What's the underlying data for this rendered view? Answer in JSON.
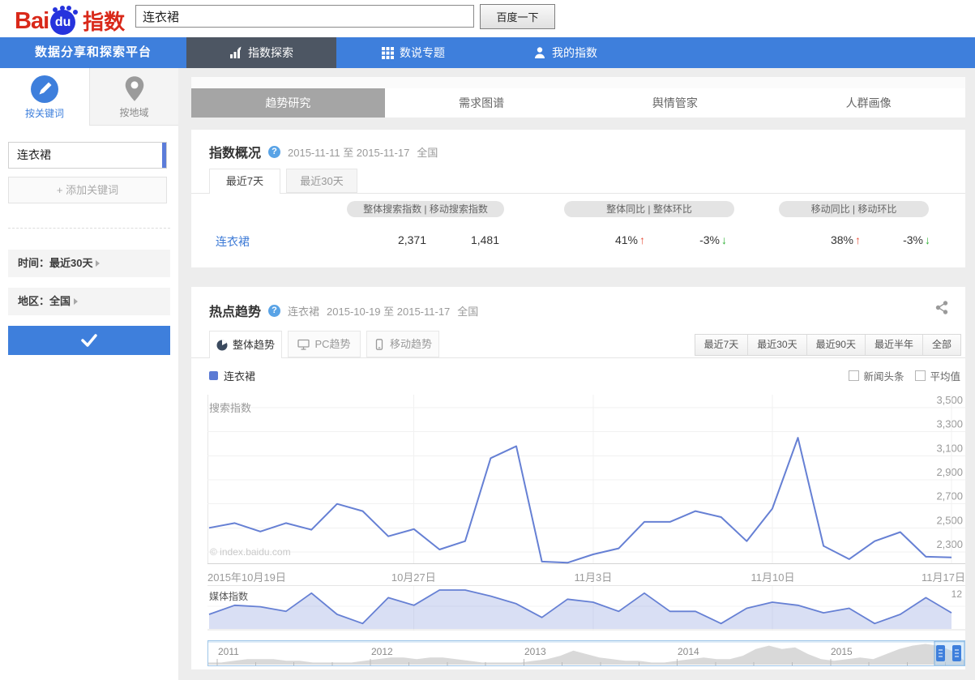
{
  "header": {
    "logo": {
      "part1": "Bai",
      "part2": "du",
      "part3": "指数"
    },
    "search": {
      "value": "连衣裙",
      "button": "百度一下"
    }
  },
  "nav": {
    "platform": "数据分享和探索平台",
    "items": [
      {
        "label": "指数探索",
        "icon": "bar-chart-icon",
        "active": true
      },
      {
        "label": "数说专题",
        "icon": "grid-icon",
        "active": false
      },
      {
        "label": "我的指数",
        "icon": "user-icon",
        "active": false
      }
    ]
  },
  "sidebar": {
    "mode_tabs": [
      {
        "label": "按关键词",
        "icon": "keyword-pencil-icon",
        "active": true
      },
      {
        "label": "按地域",
        "icon": "map-pin-icon",
        "active": false
      }
    ],
    "keyword": "连衣裙",
    "add_keyword_label": "+ 添加关键词",
    "time_filter": "时间：最近30天",
    "region_filter": "地区：全国"
  },
  "main_tabs": [
    {
      "label": "趋势研究",
      "active": true
    },
    {
      "label": "需求图谱",
      "active": false
    },
    {
      "label": "舆情管家",
      "active": false
    },
    {
      "label": "人群画像",
      "active": false
    }
  ],
  "overview": {
    "title": "指数概况",
    "date_range": "2015-11-11 至 2015-11-17",
    "region": "全国",
    "tabs": [
      {
        "label": "最近7天",
        "active": true
      },
      {
        "label": "最近30天",
        "active": false
      }
    ],
    "column_groups": [
      "整体搜索指数  |  移动搜索指数",
      "整体同比  |  整体环比",
      "移动同比  |  移动环比"
    ],
    "row": {
      "keyword": "连衣裙",
      "overall_index": "2,371",
      "mobile_index": "1,481",
      "overall_yoy": {
        "value": "41%",
        "dir": "up"
      },
      "overall_mom": {
        "value": "-3%",
        "dir": "down"
      },
      "mobile_yoy": {
        "value": "38%",
        "dir": "up"
      },
      "mobile_mom": {
        "value": "-3%",
        "dir": "down"
      }
    }
  },
  "trend": {
    "title": "热点趋势",
    "keyword": "连衣裙",
    "date_range": "2015-10-19 至 2015-11-17",
    "region": "全国",
    "tabs": [
      {
        "label": "整体趋势",
        "icon": "pie-icon",
        "active": true
      },
      {
        "label": "PC趋势",
        "icon": "monitor-icon",
        "active": false
      },
      {
        "label": "移动趋势",
        "icon": "phone-icon",
        "active": false
      }
    ],
    "range_buttons": [
      "最近7天",
      "最近30天",
      "最近90天",
      "最近半年",
      "全部"
    ],
    "legend_keyword": "连衣裙",
    "checkboxes": [
      "新闻头条",
      "平均值"
    ],
    "search_axis_label": "搜索指数",
    "media_axis_label": "媒体指数",
    "media_max_label": "12",
    "watermark": "© index.baidu.com"
  },
  "chart_data": [
    {
      "type": "line",
      "title": "搜索指数",
      "x": [
        "2015-10-19",
        "2015-10-20",
        "2015-10-21",
        "2015-10-22",
        "2015-10-23",
        "2015-10-24",
        "2015-10-25",
        "2015-10-26",
        "2015-10-27",
        "2015-10-28",
        "2015-10-29",
        "2015-10-30",
        "2015-10-31",
        "2015-11-01",
        "2015-11-02",
        "2015-11-03",
        "2015-11-04",
        "2015-11-05",
        "2015-11-06",
        "2015-11-07",
        "2015-11-08",
        "2015-11-09",
        "2015-11-10",
        "2015-11-11",
        "2015-11-12",
        "2015-11-13",
        "2015-11-14",
        "2015-11-15",
        "2015-11-16",
        "2015-11-17"
      ],
      "series": [
        {
          "name": "连衣裙",
          "values": [
            2500,
            2540,
            2470,
            2540,
            2485,
            2700,
            2640,
            2430,
            2490,
            2320,
            2390,
            3080,
            3180,
            2220,
            2210,
            2280,
            2330,
            2550,
            2550,
            2640,
            2590,
            2390,
            2660,
            3250,
            2350,
            2240,
            2390,
            2465,
            2260,
            2255
          ]
        }
      ],
      "ylim": [
        2300,
        3500
      ],
      "yticks": [
        2300,
        2500,
        2700,
        2900,
        3100,
        3300,
        3500
      ],
      "xtick_labels": [
        "2015年10月19日",
        "10月27日",
        "11月3日",
        "11月10日",
        "11月17日"
      ],
      "xtick_indices": [
        0,
        8,
        15,
        22,
        29
      ],
      "line_color": "#6680d4",
      "grid": true,
      "ylabel": "搜索指数",
      "legend_position": "top-left"
    },
    {
      "type": "area",
      "title": "媒体指数",
      "x": [
        "2015-10-19",
        "2015-10-20",
        "2015-10-21",
        "2015-10-22",
        "2015-10-23",
        "2015-10-24",
        "2015-10-25",
        "2015-10-26",
        "2015-10-27",
        "2015-10-28",
        "2015-10-29",
        "2015-10-30",
        "2015-10-31",
        "2015-11-01",
        "2015-11-02",
        "2015-11-03",
        "2015-11-04",
        "2015-11-05",
        "2015-11-06",
        "2015-11-07",
        "2015-11-08",
        "2015-11-09",
        "2015-11-10",
        "2015-11-11",
        "2015-11-12",
        "2015-11-13",
        "2015-11-14",
        "2015-11-15",
        "2015-11-16",
        "2015-11-17"
      ],
      "series": [
        {
          "name": "连衣裙",
          "values": [
            4,
            7,
            6.5,
            5,
            11,
            4,
            1,
            9.5,
            7,
            12,
            12,
            10,
            7.5,
            3,
            9,
            8,
            5,
            11,
            5,
            5,
            1,
            6,
            8,
            7,
            4.5,
            6,
            1,
            4,
            9.5,
            4.5
          ]
        }
      ],
      "ylim": [
        0,
        12
      ],
      "line_color": "#6680d4",
      "fill_color": "rgba(102,128,212,0.25)",
      "ylabel": "媒体指数"
    },
    {
      "type": "area",
      "title": "历史时间轴缩略图",
      "years": [
        "2011",
        "2012",
        "2013",
        "2014",
        "2015"
      ],
      "values": [
        1,
        1,
        2,
        3,
        3,
        3,
        2,
        2,
        1,
        1,
        1,
        1,
        2,
        3,
        4,
        4,
        3,
        4,
        4,
        3,
        2,
        1,
        1,
        1,
        1,
        2,
        3,
        5,
        8,
        6,
        4,
        3,
        2,
        2,
        1,
        1,
        2,
        3,
        4,
        3,
        3,
        5,
        9,
        11,
        9,
        10,
        6,
        3,
        2,
        3,
        4,
        3,
        6,
        9,
        11,
        12,
        11,
        8,
        2
      ],
      "ylim": [
        0,
        12
      ],
      "fill_color": "#d9d9d9",
      "selected_range_years": [
        "2015-10-19",
        "2015-11-17"
      ]
    }
  ]
}
